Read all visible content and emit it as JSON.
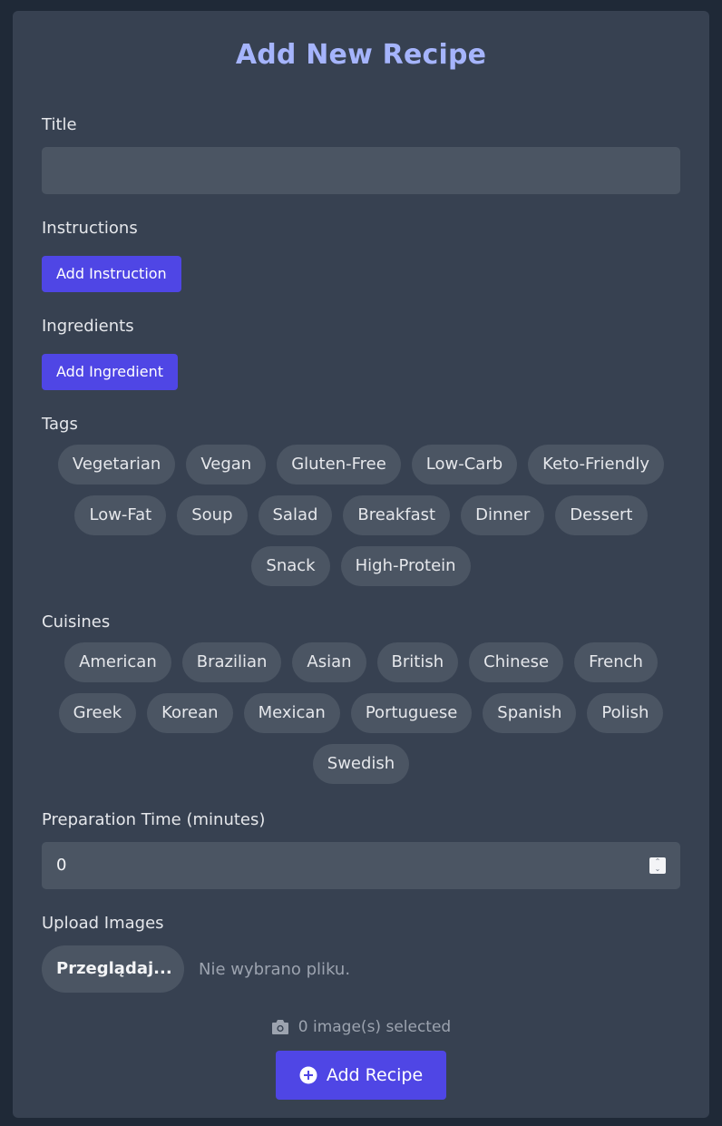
{
  "form": {
    "heading": "Add New Recipe",
    "title_label": "Title",
    "title_value": "",
    "instructions_label": "Instructions",
    "add_instruction_label": "Add Instruction",
    "ingredients_label": "Ingredients",
    "add_ingredient_label": "Add Ingredient",
    "tags_label": "Tags",
    "tags": [
      "Vegetarian",
      "Vegan",
      "Gluten-Free",
      "Low-Carb",
      "Keto-Friendly",
      "Low-Fat",
      "Soup",
      "Salad",
      "Breakfast",
      "Dinner",
      "Dessert",
      "Snack",
      "High-Protein"
    ],
    "cuisines_label": "Cuisines",
    "cuisines": [
      "American",
      "Brazilian",
      "Asian",
      "British",
      "Chinese",
      "French",
      "Greek",
      "Korean",
      "Mexican",
      "Portuguese",
      "Spanish",
      "Polish",
      "Swedish"
    ],
    "prep_time_label": "Preparation Time (minutes)",
    "prep_time_value": "0",
    "upload_label": "Upload Images",
    "browse_button_label": "Przeglądaj...",
    "file_status": "Nie wybrano pliku.",
    "images_selected": "0 image(s) selected",
    "submit_label": "Add Recipe"
  },
  "colors": {
    "page_bg": "#1f2937",
    "card_bg": "#374151",
    "input_bg": "#4b5563",
    "accent": "#4f46e5",
    "heading": "#a5b4fc"
  },
  "icons": {
    "images_indicator": "camera-icon",
    "submit": "plus-circle-icon"
  }
}
